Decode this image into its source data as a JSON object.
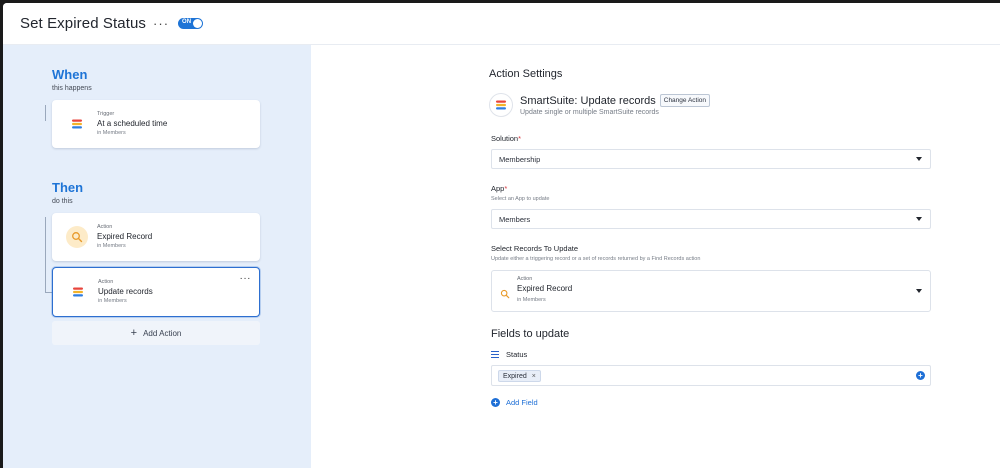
{
  "header": {
    "title": "Set Expired Status",
    "more_icon": "ellipsis-icon",
    "toggle_label": "ON"
  },
  "workflow": {
    "when": {
      "title": "When",
      "subtitle": "this happens",
      "trigger": {
        "kind": "Trigger",
        "name": "At a scheduled time",
        "sub": "in Members",
        "icon": "smartsuite-logo-icon"
      }
    },
    "then": {
      "title": "Then",
      "subtitle": "do this",
      "actions": [
        {
          "kind": "Action",
          "name": "Expired Record",
          "sub": "in Members",
          "icon": "search-icon"
        },
        {
          "kind": "Action",
          "name": "Update records",
          "sub": "in Members",
          "icon": "smartsuite-logo-icon",
          "selected": true
        }
      ]
    },
    "add_action_label": "Add Action"
  },
  "settings": {
    "title": "Action Settings",
    "app": {
      "name": "SmartSuite:",
      "action": "Update records",
      "change_label": "Change Action",
      "description": "Update single or multiple SmartSuite records"
    },
    "solution": {
      "label": "Solution",
      "required_mark": "*",
      "value": "Membership"
    },
    "app_field": {
      "label": "App",
      "required_mark": "*",
      "hint": "Select an App to update",
      "value": "Members"
    },
    "records": {
      "label": "Select Records To Update",
      "hint": "Update either a triggering record or a set of records returned by a Find Records action",
      "kind": "Action",
      "name": "Expired Record",
      "sub": "in Members"
    },
    "fields": {
      "title": "Fields to update",
      "field_name": "Status",
      "tag": "Expired",
      "tag_remove": "×",
      "add_field_label": "Add Field"
    }
  },
  "colors": {
    "accent": "#1e74d6",
    "left_panel": "#e5eefa",
    "search_icon_bg": "#fdebc8",
    "logo_red": "#e8453c",
    "logo_yellow": "#f3b32a",
    "logo_blue": "#2f7de1"
  }
}
